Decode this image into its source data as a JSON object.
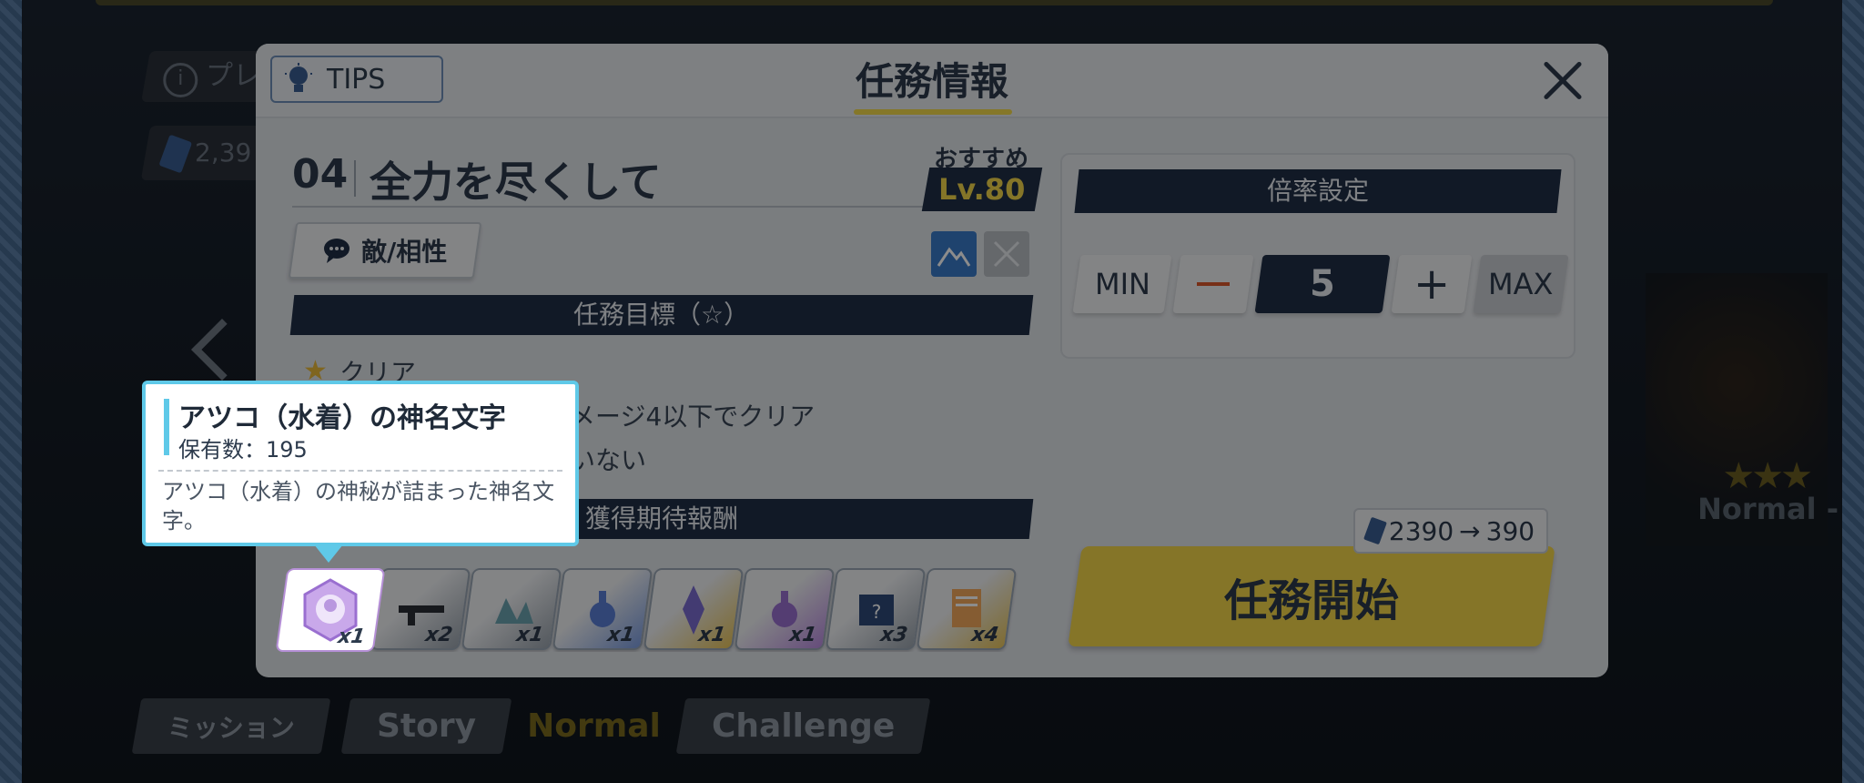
{
  "background": {
    "pill_top_text": "プレ",
    "pill_currency_text": "2,39",
    "tabs": [
      "ミッション",
      "Story",
      "Normal",
      "Challenge"
    ],
    "right_label": "Normal -"
  },
  "dialog": {
    "tips_label": "TIPS",
    "title": "任務情報",
    "mission_number": "04",
    "mission_name": "全力を尽くして",
    "recommended_label": "おすすめ",
    "recommended_level": "Lv.80",
    "enemy_button_label": "敵/相性",
    "objectives_header": "任務目標（☆）",
    "objectives": [
      "クリア",
      "メージ4以下でクリア",
      "いない"
    ],
    "rewards_header": "獲得期待報酬",
    "rewards": [
      {
        "name": "artifact-hexagon",
        "qty": "x1",
        "color": "#b98be0"
      },
      {
        "name": "rifle",
        "qty": "x2",
        "color": "#9aa3ad"
      },
      {
        "name": "crystal-cluster",
        "qty": "x1",
        "color": "#9aa3ad"
      },
      {
        "name": "potion-blue",
        "qty": "x1",
        "color": "#7b9ce0"
      },
      {
        "name": "crystal-gold",
        "qty": "x1",
        "color": "#e8c45a"
      },
      {
        "name": "potion-purple",
        "qty": "x1",
        "color": "#b98be0"
      },
      {
        "name": "mystery-box",
        "qty": "x3",
        "color": "#9aa3ad"
      },
      {
        "name": "report-clipboard",
        "qty": "x4",
        "color": "#e8c45a"
      }
    ],
    "rate_header": "倍率設定",
    "rate_min": "MIN",
    "rate_value": "5",
    "rate_max": "MAX",
    "cost_before": "2390",
    "cost_after": "390",
    "start_button": "任務開始"
  },
  "tooltip": {
    "title": "アツコ（水着）の神名文字",
    "count": "保有数：195",
    "description": "アツコ（水着）の神秘が詰まった神名文字。"
  },
  "selected_reward_qty": "x1"
}
